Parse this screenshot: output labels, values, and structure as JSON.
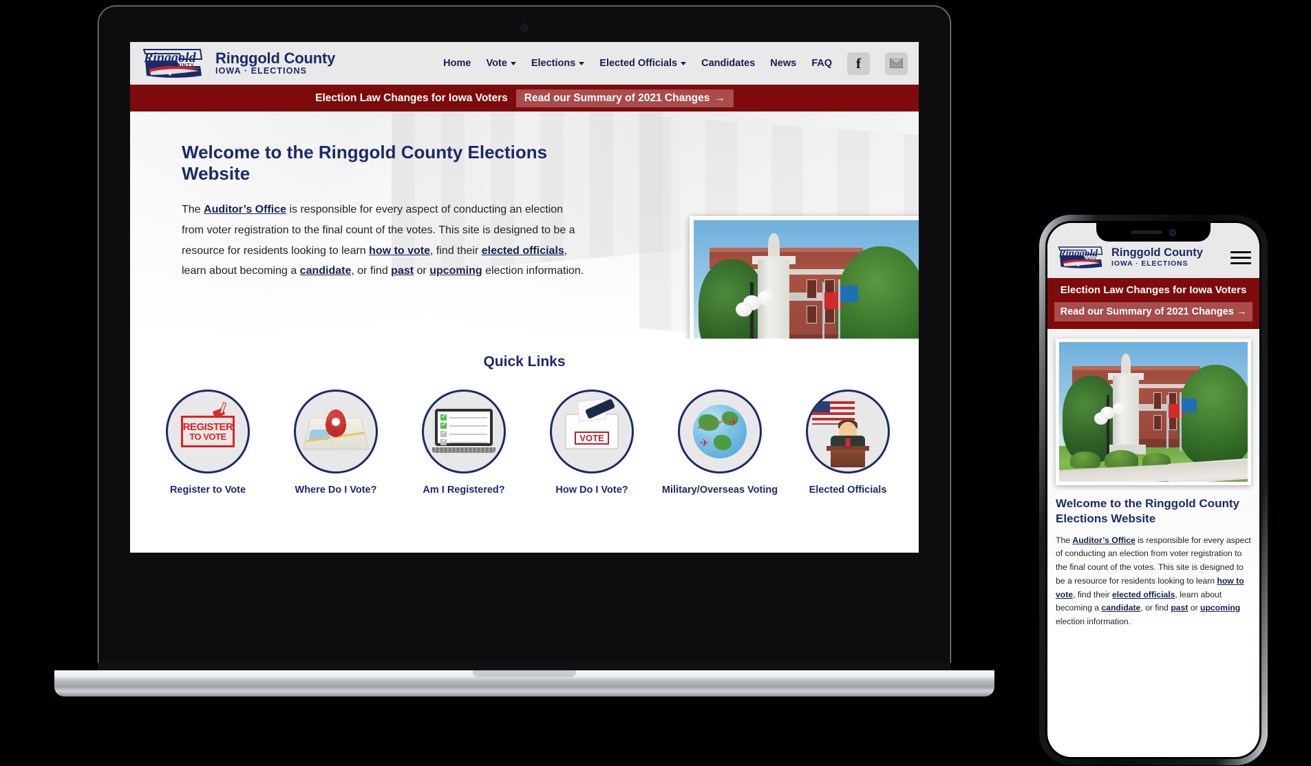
{
  "site": {
    "brand": {
      "name": "Ringgold County",
      "sub": "IOWA · ELECTIONS",
      "logo_icon": "ringgold-county-logo"
    },
    "nav": [
      {
        "label": "Home",
        "has_caret": false
      },
      {
        "label": "Vote",
        "has_caret": true
      },
      {
        "label": "Elections",
        "has_caret": true
      },
      {
        "label": "Elected Officials",
        "has_caret": true
      },
      {
        "label": "Candidates",
        "has_caret": false
      },
      {
        "label": "News",
        "has_caret": false
      },
      {
        "label": "FAQ",
        "has_caret": false
      }
    ],
    "social": {
      "facebook_icon": "facebook-icon",
      "facebook_glyph": "f",
      "email_icon": "envelope-icon"
    },
    "alert": {
      "text": "Election Law Changes for Iowa Voters",
      "button": "Read our Summary of 2021 Changes",
      "arrow": "→",
      "bg": "#7e0b0b",
      "button_bg": "#a84c4c"
    },
    "hero": {
      "heading": "Welcome to the Ringgold County Elections Website",
      "p1_pre": "The ",
      "link_auditor": "Auditor’s Office",
      "p1_mid": " is responsible for every aspect of conducting an election from voter registration to the final count of the votes. This site is designed to be a resource for residents looking to learn ",
      "link_howtovote": "how to vote",
      "p1_mid2": ", find their ",
      "link_elected": "elected officials",
      "p1_mid3": ", learn about becoming a ",
      "link_candidate": "candidate",
      "p1_mid4": ", or find ",
      "link_past": "past",
      "p1_mid5": " or ",
      "link_upcoming": "upcoming",
      "p1_end": " election information.",
      "photo_alt": "ringgold-county-courthouse-photo"
    },
    "quick_links": {
      "title": "Quick Links",
      "items": [
        {
          "label": "Register to Vote",
          "icon": "register-to-vote-icon"
        },
        {
          "label": "Where Do I Vote?",
          "icon": "map-pin-icon"
        },
        {
          "label": "Am I Registered?",
          "icon": "laptop-checklist-icon"
        },
        {
          "label": "How Do I Vote?",
          "icon": "ballot-box-icon"
        },
        {
          "label": "Military/Overseas Voting",
          "icon": "globe-airplane-icon"
        },
        {
          "label": "Elected Officials",
          "icon": "official-podium-icon"
        }
      ]
    },
    "colors": {
      "navy": "#1b2a6b",
      "dark_red": "#7e0b0b",
      "light_red": "#a84c4c",
      "header_gray": "#e9e9e9"
    }
  },
  "mobile": {
    "brand": {
      "name": "Ringgold County",
      "sub": "IOWA · ELECTIONS"
    },
    "menu_icon": "hamburger-menu-icon",
    "alert": {
      "text": "Election Law Changes for Iowa Voters",
      "button": "Read our Summary of 2021 Changes",
      "arrow": "→"
    },
    "heading": "Welcome to the Ringgold County Elections Website",
    "paragraph_pre": "The ",
    "link_auditor": "Auditor’s Office",
    "paragraph_mid": " is responsible for every aspect of conducting an election from voter registration to the final count of the votes. This site is designed to be a resource for residents looking to learn ",
    "link_howtovote": "how to vote",
    "paragraph_mid2": ", find their ",
    "link_elected": "elected officials",
    "paragraph_mid3": ", learn about becoming a ",
    "link_candidate": "candidate",
    "paragraph_mid4": ", or find ",
    "link_past": "past",
    "paragraph_mid5": " or ",
    "link_upcoming": "upcoming",
    "paragraph_end": " election information.",
    "photo_alt": "ringgold-county-courthouse-photo"
  },
  "devices": {
    "laptop": "laptop-mockup",
    "phone": "smartphone-mockup"
  }
}
